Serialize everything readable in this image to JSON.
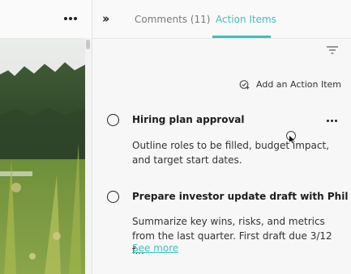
{
  "toolbar": {
    "more_icon": "more-horizontal-icon",
    "collapse_icon": "double-chevron-right-icon",
    "collapse_glyph": "››"
  },
  "tabs": [
    {
      "label": "Comments (11)",
      "active": false
    },
    {
      "label": "Action Items",
      "active": true
    }
  ],
  "panel": {
    "filter_icon": "filter-icon",
    "add_action_label": "Add an Action Item",
    "add_action_icon": "add-check-icon"
  },
  "action_items": [
    {
      "title": "Hiring plan approval",
      "description": "Outline roles to be filled, budget impact, and target start dates.",
      "has_menu": true
    },
    {
      "title": "Prepare investor update draft with Phil",
      "description": "Summarize key wins, risks, and metrics from the last quarter. First draft due 3/12 f...",
      "see_more": "See more"
    }
  ],
  "colors": {
    "accent": "#3fbfbd",
    "text": "#222222",
    "muted": "#7a7a7a",
    "panel_bg": "#f7f7f7"
  }
}
